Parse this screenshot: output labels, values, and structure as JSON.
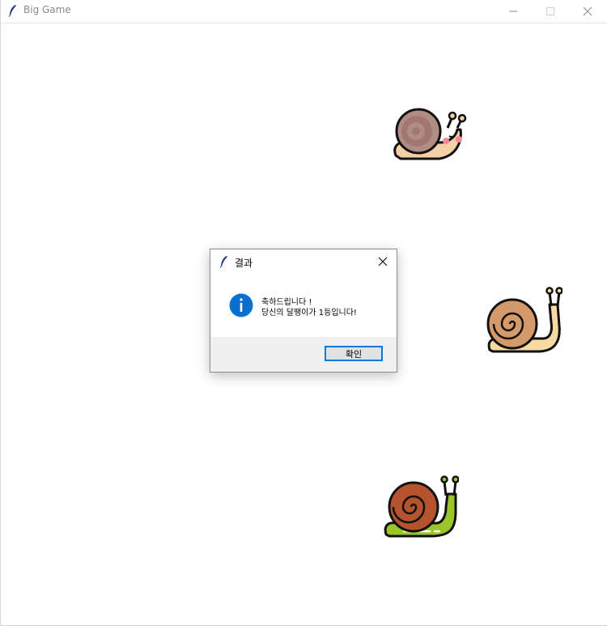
{
  "window": {
    "title": "Big Game",
    "controls": [
      "minimize",
      "maximize",
      "close"
    ]
  },
  "canvas": {
    "snails": [
      {
        "name": "snail-pink",
        "colors": {
          "shell": "#b08c84",
          "body": "#f5cfa6",
          "cheek": "#f08a9a"
        }
      },
      {
        "name": "snail-tan",
        "colors": {
          "shell": "#d49a6a",
          "body": "#f7d9a2"
        }
      },
      {
        "name": "snail-green",
        "colors": {
          "shell": "#b5532f",
          "body": "#9bc62a"
        }
      }
    ]
  },
  "dialog": {
    "title": "결과",
    "message_line_1": "축하드립니다 !",
    "message_line_2": "당신의 달팽이가 1등입니다!",
    "ok_label": "확인",
    "icon": "info-icon",
    "accent_color": "#0078d7"
  }
}
